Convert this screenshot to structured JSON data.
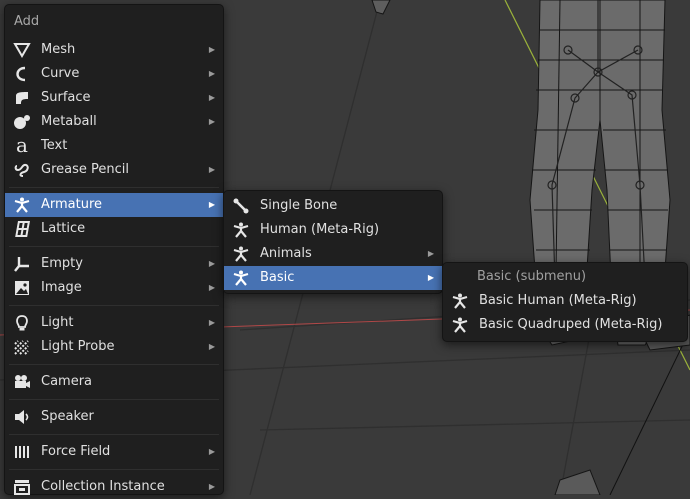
{
  "main_menu": {
    "title": "Add",
    "items": [
      {
        "label": "Mesh",
        "icon": "mesh-icon"
      },
      {
        "label": "Curve",
        "icon": "curve-icon"
      },
      {
        "label": "Surface",
        "icon": "surface-icon"
      },
      {
        "label": "Metaball",
        "icon": "metaball-icon"
      },
      {
        "label": "Text",
        "icon": "text-icon"
      },
      {
        "label": "Grease Pencil",
        "icon": "grease-pencil-icon"
      },
      {
        "label": "Armature",
        "icon": "armature-icon"
      },
      {
        "label": "Lattice",
        "icon": "lattice-icon"
      },
      {
        "label": "Empty",
        "icon": "empty-icon"
      },
      {
        "label": "Image",
        "icon": "image-icon"
      },
      {
        "label": "Light",
        "icon": "light-icon"
      },
      {
        "label": "Light Probe",
        "icon": "light-probe-icon"
      },
      {
        "label": "Camera",
        "icon": "camera-icon"
      },
      {
        "label": "Speaker",
        "icon": "speaker-icon"
      },
      {
        "label": "Force Field",
        "icon": "force-field-icon"
      },
      {
        "label": "Collection Instance",
        "icon": "collection-instance-icon"
      }
    ]
  },
  "armature_menu": {
    "items": [
      {
        "label": "Single Bone",
        "icon": "bone-icon"
      },
      {
        "label": "Human (Meta-Rig)",
        "icon": "armature-icon"
      },
      {
        "label": "Animals",
        "icon": "armature-icon"
      },
      {
        "label": "Basic",
        "icon": "armature-icon"
      }
    ]
  },
  "basic_menu": {
    "title": "Basic (submenu)",
    "items": [
      {
        "label": "Basic Human (Meta-Rig)",
        "icon": "armature-icon"
      },
      {
        "label": "Basic Quadruped (Meta-Rig)",
        "icon": "armature-icon"
      }
    ]
  },
  "colors": {
    "menu_bg": "#1f1f1f",
    "highlight": "#4772b3",
    "viewport_bg": "#3a3a3a",
    "y_axis": "#9ab23a",
    "x_axis": "#c04848"
  }
}
